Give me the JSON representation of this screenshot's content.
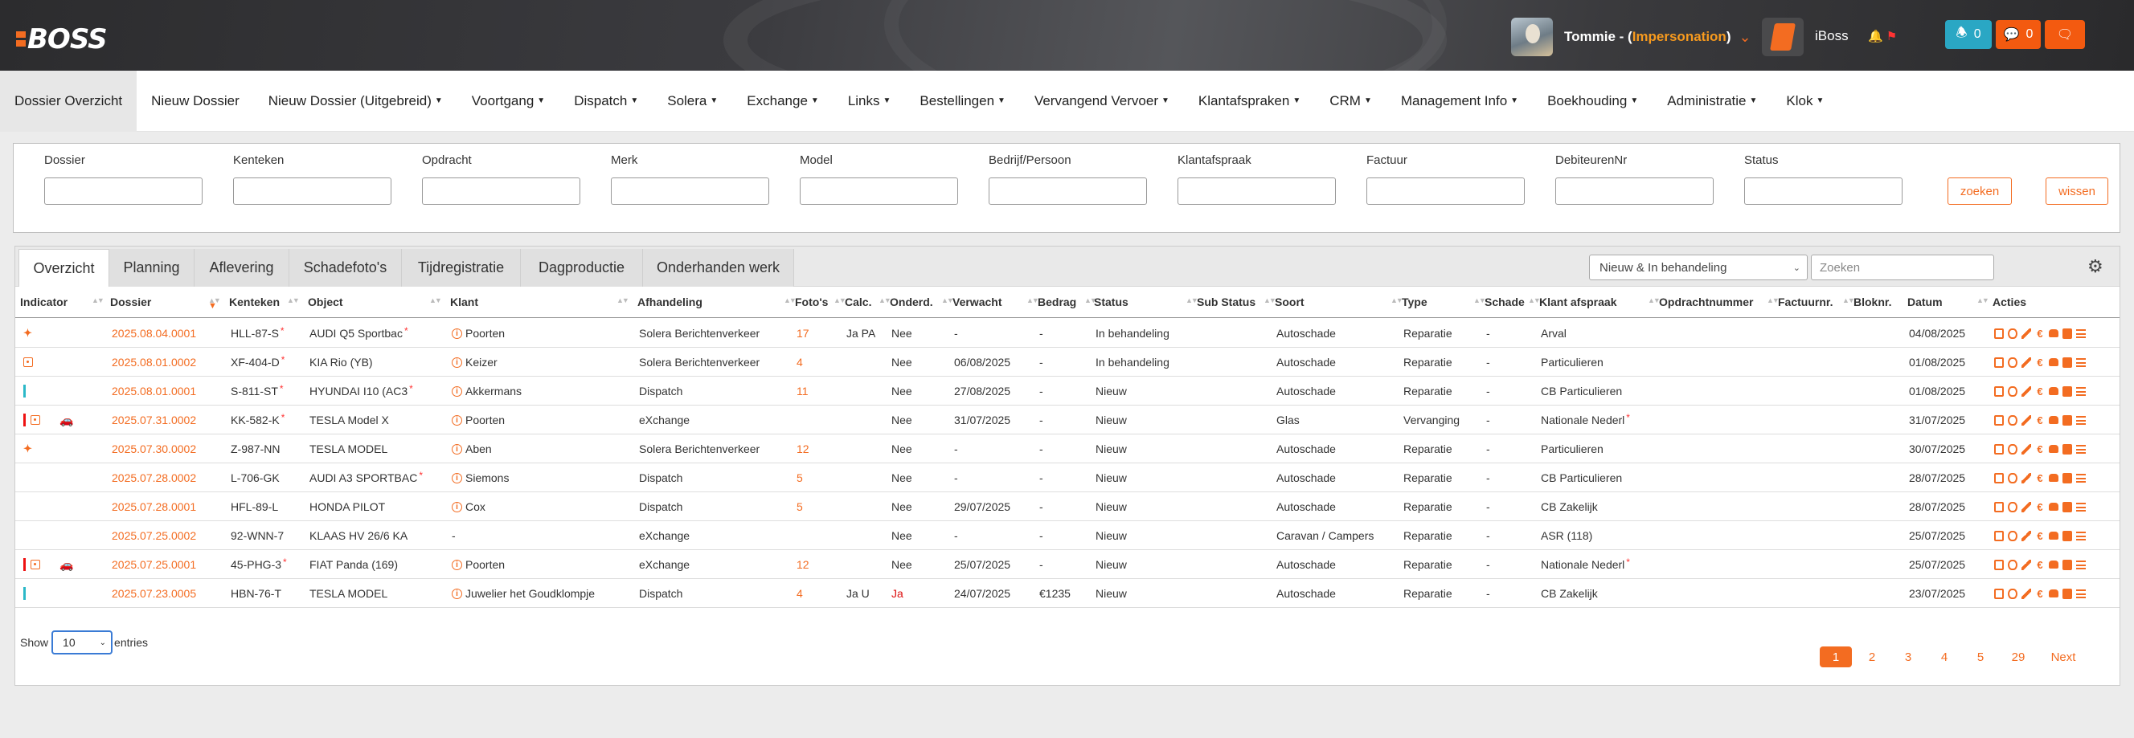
{
  "app": {
    "logo": "BOSS"
  },
  "header": {
    "user_name": "Tommie - (",
    "impersonation": "Impersonation",
    "user_close": ")",
    "company": "iBoss",
    "notifications_count": "0",
    "messages_count": "0"
  },
  "nav": [
    {
      "label": "Dossier Overzicht",
      "dropdown": false,
      "active": true
    },
    {
      "label": "Nieuw Dossier",
      "dropdown": false
    },
    {
      "label": "Nieuw Dossier (Uitgebreid)",
      "dropdown": true
    },
    {
      "label": "Voortgang",
      "dropdown": true
    },
    {
      "label": "Dispatch",
      "dropdown": true
    },
    {
      "label": "Solera",
      "dropdown": true
    },
    {
      "label": "Exchange",
      "dropdown": true
    },
    {
      "label": "Links",
      "dropdown": true
    },
    {
      "label": "Bestellingen",
      "dropdown": true
    },
    {
      "label": "Vervangend Vervoer",
      "dropdown": true
    },
    {
      "label": "Klantafspraken",
      "dropdown": true
    },
    {
      "label": "CRM",
      "dropdown": true
    },
    {
      "label": "Management Info",
      "dropdown": true
    },
    {
      "label": "Boekhouding",
      "dropdown": true
    },
    {
      "label": "Administratie",
      "dropdown": true
    },
    {
      "label": "Klok",
      "dropdown": true
    }
  ],
  "filters": {
    "fields": [
      "Dossier",
      "Kenteken",
      "Opdracht",
      "Merk",
      "Model",
      "Bedrijf/Persoon",
      "Klantafspraak",
      "Factuur",
      "DebiteurenNr",
      "Status"
    ],
    "search_label": "zoeken",
    "clear_label": "wissen"
  },
  "tabs": [
    "Overzicht",
    "Planning",
    "Aflevering",
    "Schadefoto's",
    "Tijdregistratie",
    "Dagproductie",
    "Onderhanden werk"
  ],
  "status_filter": "Nieuw & In behandeling",
  "search_placeholder": "Zoeken",
  "columns": [
    "Indicator",
    "Dossier",
    "Kenteken",
    "Object",
    "Klant",
    "Afhandeling",
    "Foto's",
    "Calc.",
    "Onderd.",
    "Verwacht",
    "Bedrag",
    "Status",
    "Sub Status",
    "Soort",
    "Type",
    "Schade",
    "Klant afspraak",
    "Opdrachtnummer",
    "Factuurnr.",
    "Bloknr.",
    "Datum",
    "Acties"
  ],
  "rows": [
    {
      "ind": [
        "spark"
      ],
      "dossier": "2025.08.04.0001",
      "kenteken": "HLL-87-S",
      "kent_ast": true,
      "object": "AUDI Q5 Sportbac",
      "obj_ast": true,
      "klant": "Poorten",
      "klant_info": true,
      "afhandeling": "Solera Berichtenverkeer",
      "fotos": "17",
      "calc": "Ja PA",
      "onderd": "Nee",
      "onderd_red": false,
      "verwacht": "-",
      "bedrag": "-",
      "status": "In behandeling",
      "soort": "Autoschade",
      "type": "Reparatie",
      "schade": "-",
      "afspraak": "Arval",
      "afspr_ast": false,
      "datum": "04/08/2025"
    },
    {
      "ind": [
        "sq"
      ],
      "dossier": "2025.08.01.0002",
      "kenteken": "XF-404-D",
      "kent_ast": true,
      "object": "KIA Rio (YB)",
      "obj_ast": false,
      "klant": "Keizer",
      "klant_info": true,
      "afhandeling": "Solera Berichtenverkeer",
      "fotos": "4",
      "calc": "",
      "onderd": "Nee",
      "onderd_red": false,
      "verwacht": "06/08/2025",
      "bedrag": "-",
      "status": "In behandeling",
      "soort": "Autoschade",
      "type": "Reparatie",
      "schade": "-",
      "afspraak": "Particulieren",
      "afspr_ast": false,
      "datum": "01/08/2025"
    },
    {
      "ind": [
        "teal"
      ],
      "dossier": "2025.08.01.0001",
      "kenteken": "S-811-ST",
      "kent_ast": true,
      "object": "HYUNDAI I10 (AC3",
      "obj_ast": true,
      "klant": "Akkermans",
      "klant_info": true,
      "afhandeling": "Dispatch",
      "fotos": "11",
      "calc": "",
      "onderd": "Nee",
      "onderd_red": false,
      "verwacht": "27/08/2025",
      "bedrag": "-",
      "status": "Nieuw",
      "soort": "Autoschade",
      "type": "Reparatie",
      "schade": "-",
      "afspraak": "CB Particulieren",
      "afspr_ast": false,
      "datum": "01/08/2025"
    },
    {
      "ind": [
        "red",
        "sq",
        "car"
      ],
      "dossier": "2025.07.31.0002",
      "kenteken": "KK-582-K",
      "kent_ast": true,
      "object": "TESLA Model X",
      "obj_ast": false,
      "klant": "Poorten",
      "klant_info": true,
      "afhandeling": "eXchange",
      "fotos": "",
      "calc": "",
      "onderd": "Nee",
      "onderd_red": false,
      "verwacht": "31/07/2025",
      "bedrag": "-",
      "status": "Nieuw",
      "soort": "Glas",
      "type": "Vervanging",
      "schade": "-",
      "afspraak": "Nationale Nederl",
      "afspr_ast": true,
      "datum": "31/07/2025"
    },
    {
      "ind": [
        "spark"
      ],
      "dossier": "2025.07.30.0002",
      "kenteken": "Z-987-NN",
      "kent_ast": false,
      "object": "TESLA MODEL",
      "obj_ast": false,
      "klant": "Aben",
      "klant_info": true,
      "afhandeling": "Solera Berichtenverkeer",
      "fotos": "12",
      "calc": "",
      "onderd": "Nee",
      "onderd_red": false,
      "verwacht": "-",
      "bedrag": "-",
      "status": "Nieuw",
      "soort": "Autoschade",
      "type": "Reparatie",
      "schade": "-",
      "afspraak": "Particulieren",
      "afspr_ast": false,
      "datum": "30/07/2025"
    },
    {
      "ind": [],
      "dossier": "2025.07.28.0002",
      "kenteken": "L-706-GK",
      "kent_ast": false,
      "object": "AUDI A3 SPORTBAC",
      "obj_ast": true,
      "klant": "Siemons",
      "klant_info": true,
      "afhandeling": "Dispatch",
      "fotos": "5",
      "calc": "",
      "onderd": "Nee",
      "onderd_red": false,
      "verwacht": "-",
      "bedrag": "-",
      "status": "Nieuw",
      "soort": "Autoschade",
      "type": "Reparatie",
      "schade": "-",
      "afspraak": "CB Particulieren",
      "afspr_ast": false,
      "datum": "28/07/2025"
    },
    {
      "ind": [],
      "dossier": "2025.07.28.0001",
      "kenteken": "HFL-89-L",
      "kent_ast": false,
      "object": "HONDA PILOT",
      "obj_ast": false,
      "klant": "Cox",
      "klant_info": true,
      "afhandeling": "Dispatch",
      "fotos": "5",
      "calc": "",
      "onderd": "Nee",
      "onderd_red": false,
      "verwacht": "29/07/2025",
      "bedrag": "-",
      "status": "Nieuw",
      "soort": "Autoschade",
      "type": "Reparatie",
      "schade": "-",
      "afspraak": "CB Zakelijk",
      "afspr_ast": false,
      "datum": "28/07/2025"
    },
    {
      "ind": [],
      "dossier": "2025.07.25.0002",
      "kenteken": "92-WNN-7",
      "kent_ast": false,
      "object": "KLAAS HV 26/6 KA",
      "obj_ast": false,
      "klant": "-",
      "klant_info": false,
      "afhandeling": "eXchange",
      "fotos": "",
      "calc": "",
      "onderd": "Nee",
      "onderd_red": false,
      "verwacht": "-",
      "bedrag": "-",
      "status": "Nieuw",
      "soort": "Caravan / Campers",
      "type": "Reparatie",
      "schade": "-",
      "afspraak": "ASR (118)",
      "afspr_ast": false,
      "datum": "25/07/2025"
    },
    {
      "ind": [
        "red",
        "sq",
        "car"
      ],
      "dossier": "2025.07.25.0001",
      "kenteken": "45-PHG-3",
      "kent_ast": true,
      "object": "FIAT Panda (169)",
      "obj_ast": false,
      "klant": "Poorten",
      "klant_info": true,
      "afhandeling": "eXchange",
      "fotos": "12",
      "calc": "",
      "onderd": "Nee",
      "onderd_red": false,
      "verwacht": "25/07/2025",
      "bedrag": "-",
      "status": "Nieuw",
      "soort": "Autoschade",
      "type": "Reparatie",
      "schade": "-",
      "afspraak": "Nationale Nederl",
      "afspr_ast": true,
      "datum": "25/07/2025"
    },
    {
      "ind": [
        "teal"
      ],
      "dossier": "2025.07.23.0005",
      "kenteken": "HBN-76-T",
      "kent_ast": false,
      "object": "TESLA MODEL",
      "obj_ast": false,
      "klant": "Juwelier het Goudklompje",
      "klant_info": true,
      "afhandeling": "Dispatch",
      "fotos": "4",
      "calc": "Ja U",
      "onderd": "Ja",
      "onderd_red": true,
      "verwacht": "24/07/2025",
      "bedrag": "€1235",
      "status": "Nieuw",
      "soort": "Autoschade",
      "type": "Reparatie",
      "schade": "-",
      "afspraak": "CB Zakelijk",
      "afspr_ast": false,
      "datum": "23/07/2025"
    }
  ],
  "footer": {
    "show_label": "Show",
    "entries_value": "10",
    "entries_label": "entries",
    "pages": [
      "1",
      "2",
      "3",
      "4",
      "5",
      "29"
    ],
    "next_label": "Next"
  },
  "colors": {
    "accent": "#f36c21",
    "teal": "#2aa7c4",
    "alert_red": "#e11111"
  }
}
